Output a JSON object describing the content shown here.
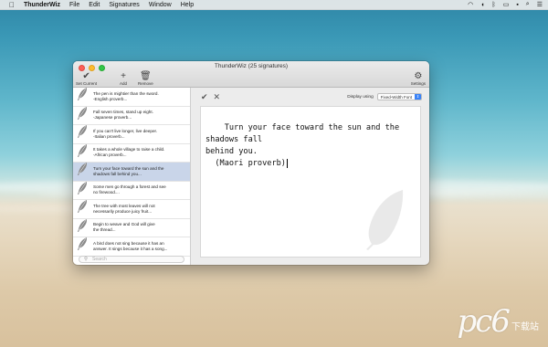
{
  "menubar": {
    "app_name": "ThunderWiz",
    "items": [
      "File",
      "Edit",
      "Signatures",
      "Window",
      "Help"
    ]
  },
  "window": {
    "title": "ThunderWiz (25 signatures)",
    "toolbar": {
      "set_current": "Set Current",
      "add": "Add",
      "remove": "Remove",
      "settings": "Settings"
    }
  },
  "signatures": [
    {
      "text": "The pen is mightier than the sword.\n    -English proverb..."
    },
    {
      "text": "Fall seven times, stand up eight.\n    -Japanese proverb..."
    },
    {
      "text": "If you can't live longer, live deeper.\n    -Italian proverb..."
    },
    {
      "text": "It takes a whole village to raise a child.\n    -African proverb..."
    },
    {
      "text": "Turn your face toward the sun and the\nshadows fall behind you..."
    },
    {
      "text": "Some men go through a forest and see\nno firewood...."
    },
    {
      "text": "The tree with most leaves will not\nnecessarily produce juicy fruit..."
    },
    {
      "text": "Begin to weave and God will give\nthe thread..."
    },
    {
      "text": "A bird does not sing because it has an\nanswer. It sings because it has a song..."
    }
  ],
  "selected_index": 4,
  "search": {
    "placeholder": "Search"
  },
  "editor": {
    "display_label": "Display using",
    "display_value": "Fixed-Width Font",
    "content": "Turn your face toward the sun and the shadows fall\nbehind you.\n  (Maori proverb)"
  },
  "watermark": {
    "logo": "pc6",
    "text": "下载站"
  },
  "colors": {
    "selected_row": "#c9d5e9",
    "accent": "#3b83f7"
  }
}
